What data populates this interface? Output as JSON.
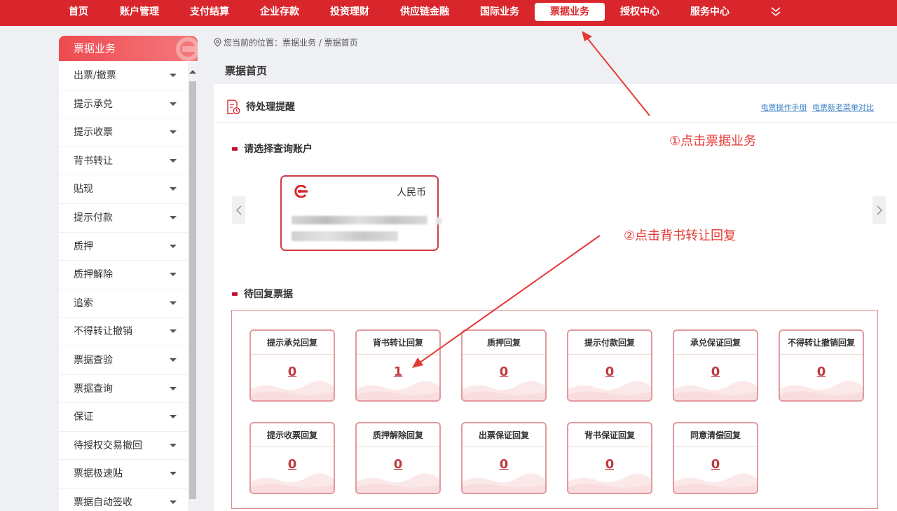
{
  "nav": {
    "items": [
      "首页",
      "账户管理",
      "支付结算",
      "企业存款",
      "投资理财",
      "供应链金融",
      "国际业务",
      "票据业务",
      "授权中心",
      "服务中心"
    ],
    "active_index": 7,
    "more_icon": "double-chevron-down-icon"
  },
  "sidebar": {
    "title": "票据业务",
    "items": [
      "出票/撤票",
      "提示承兑",
      "提示收票",
      "背书转让",
      "贴现",
      "提示付款",
      "质押",
      "质押解除",
      "追索",
      "不得转让撤销",
      "票据查验",
      "票据查询",
      "保证",
      "待授权交易撤回",
      "票据极速贴",
      "票据自动签收"
    ]
  },
  "breadcrumb": "您当前的位置：票据业务 / 票据首页",
  "page_title": "票据首页",
  "panel": {
    "title": "待处理提醒",
    "links": [
      "电票操作手册",
      "电票新老菜单对比"
    ]
  },
  "account_section": {
    "label": "请选择查询账户",
    "card": {
      "currency": "人民币"
    }
  },
  "reply_section": {
    "label": "待回复票据",
    "cards": [
      {
        "label": "提示承兑回复",
        "count": "0"
      },
      {
        "label": "背书转让回复",
        "count": "1"
      },
      {
        "label": "质押回复",
        "count": "0"
      },
      {
        "label": "提示付款回复",
        "count": "0"
      },
      {
        "label": "承兑保证回复",
        "count": "0"
      },
      {
        "label": "不得转让撤销回复",
        "count": "0"
      },
      {
        "label": "提示收票回复",
        "count": "0"
      },
      {
        "label": "质押解除回复",
        "count": "0"
      },
      {
        "label": "出票保证回复",
        "count": "0"
      },
      {
        "label": "背书保证回复",
        "count": "0"
      },
      {
        "label": "同意清偿回复",
        "count": "0"
      }
    ]
  },
  "annotations": {
    "step1": "①点击票据业务",
    "step2": "②点击背书转让回复",
    "color": "#e53935"
  },
  "colors": {
    "brand": "#d9262c",
    "accent": "#c8102e"
  }
}
